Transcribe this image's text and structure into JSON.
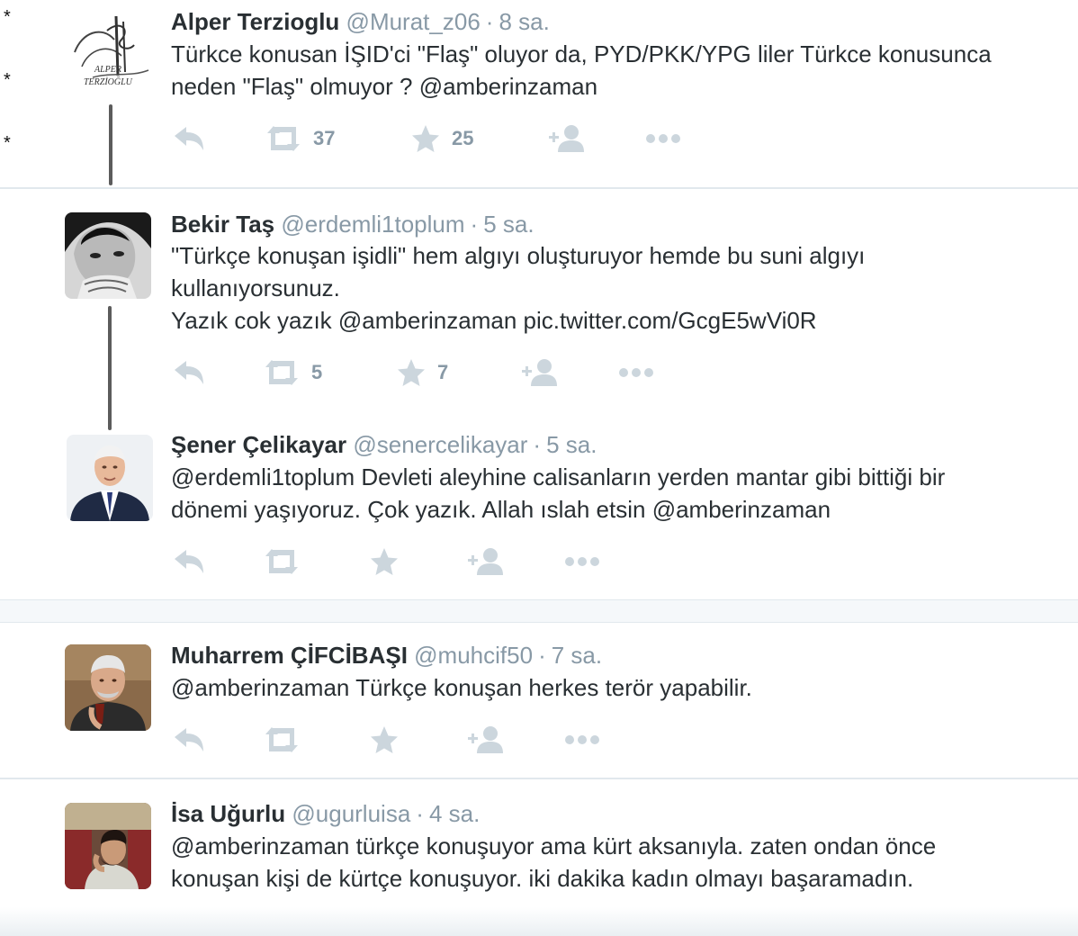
{
  "markers": [
    "*",
    "*",
    "*"
  ],
  "colors": {
    "icon": "#ccd6dd",
    "meta": "#8899a6",
    "text": "#292f33",
    "separator": "#e1e8ed",
    "gap": "#f5f8fa",
    "thread": "#5c5c5c"
  },
  "tweets": [
    {
      "name": "Alper Terzioglu",
      "handle": "@Murat_z06",
      "time": "8 sa.",
      "avatar_text": [
        "ALPER",
        "TERZİOĞLU"
      ],
      "lines": [
        "Türkce konusan İŞID'ci \"Flaş\" oluyor da, PYD/PKK/YPG liler Türkce konusunca",
        "neden \"Flaş\" olmuyor ? @amberinzaman"
      ],
      "retweets": "37",
      "favorites": "25"
    },
    {
      "name": "Bekir Taş",
      "handle": "@erdemli1toplum",
      "time": "5 sa.",
      "lines": [
        "\"Türkçe konuşan işidli\" hem algıyı oluşturuyor hemde bu suni algıyı",
        "kullanıyorsunuz.",
        "Yazık cok yazık @amberinzaman pic.twitter.com/GcgE5wVi0R"
      ],
      "retweets": "5",
      "favorites": "7"
    },
    {
      "name": "Şener Çelikayar",
      "handle": "@senercelikayar",
      "time": "5 sa.",
      "lines": [
        "@erdemli1toplum Devleti aleyhine calisanların yerden mantar gibi bittiği bir",
        "dönemi yaşıyoruz. Çok yazık.  Allah ıslah etsin @amberinzaman"
      ],
      "retweets": "",
      "favorites": ""
    },
    {
      "name": "Muharrem ÇİFCİBAŞI",
      "handle": "@muhcif50",
      "time": "7 sa.",
      "lines": [
        "@amberinzaman Türkçe konuşan herkes terör yapabilir."
      ],
      "retweets": "",
      "favorites": ""
    },
    {
      "name": "İsa Uğurlu",
      "handle": "@ugurluisa",
      "time": "4 sa.",
      "lines": [
        "@amberinzaman türkçe konuşuyor ama kürt aksanıyla. zaten ondan önce",
        "konuşan kişi de kürtçe konuşuyor. iki dakika kadın olmayı başaramadın."
      ],
      "retweets": "",
      "favorites": ""
    }
  ]
}
